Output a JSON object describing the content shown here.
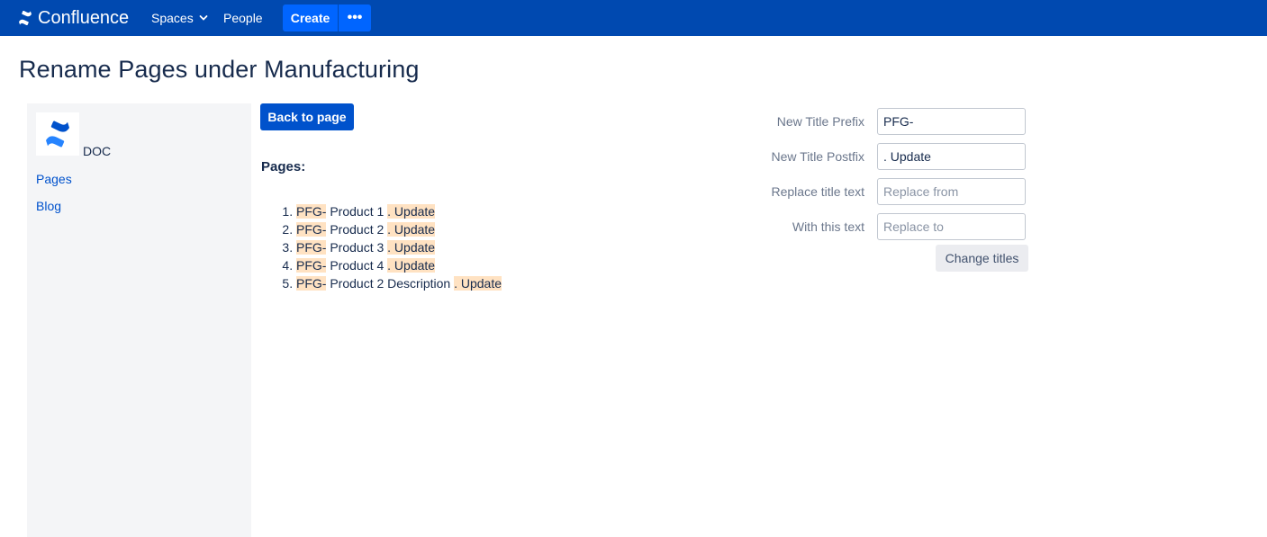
{
  "topnav": {
    "logo_text": "Confluence",
    "spaces_label": "Spaces",
    "people_label": "People",
    "create_label": "Create",
    "more_label": "•••"
  },
  "page": {
    "title": "Rename Pages under Manufacturing"
  },
  "sidebar": {
    "space_name": "DOC",
    "links": [
      "Pages",
      "Blog"
    ]
  },
  "main": {
    "back_label": "Back to page",
    "pages_heading": "Pages:",
    "pages": [
      {
        "prefix": "PFG-",
        "title": " Product 1 ",
        "postfix": ". Update"
      },
      {
        "prefix": "PFG-",
        "title": " Product 2 ",
        "postfix": ". Update"
      },
      {
        "prefix": "PFG-",
        "title": " Product 3 ",
        "postfix": ". Update"
      },
      {
        "prefix": "PFG-",
        "title": " Product 4 ",
        "postfix": ". Update"
      },
      {
        "prefix": "PFG-",
        "title": " Product 2 Description ",
        "postfix": ". Update"
      }
    ]
  },
  "form": {
    "prefix_label": "New Title Prefix",
    "prefix_value": "PFG-",
    "postfix_label": "New Title Postfix",
    "postfix_value": ". Update",
    "replace_label": "Replace title text",
    "replace_placeholder": "Replace from",
    "with_label": "With this text",
    "with_placeholder": "Replace to",
    "submit_label": "Change titles"
  },
  "colors": {
    "nav_bg": "#0049b0",
    "primary": "#0052cc",
    "highlight": "#ffe2c2"
  }
}
